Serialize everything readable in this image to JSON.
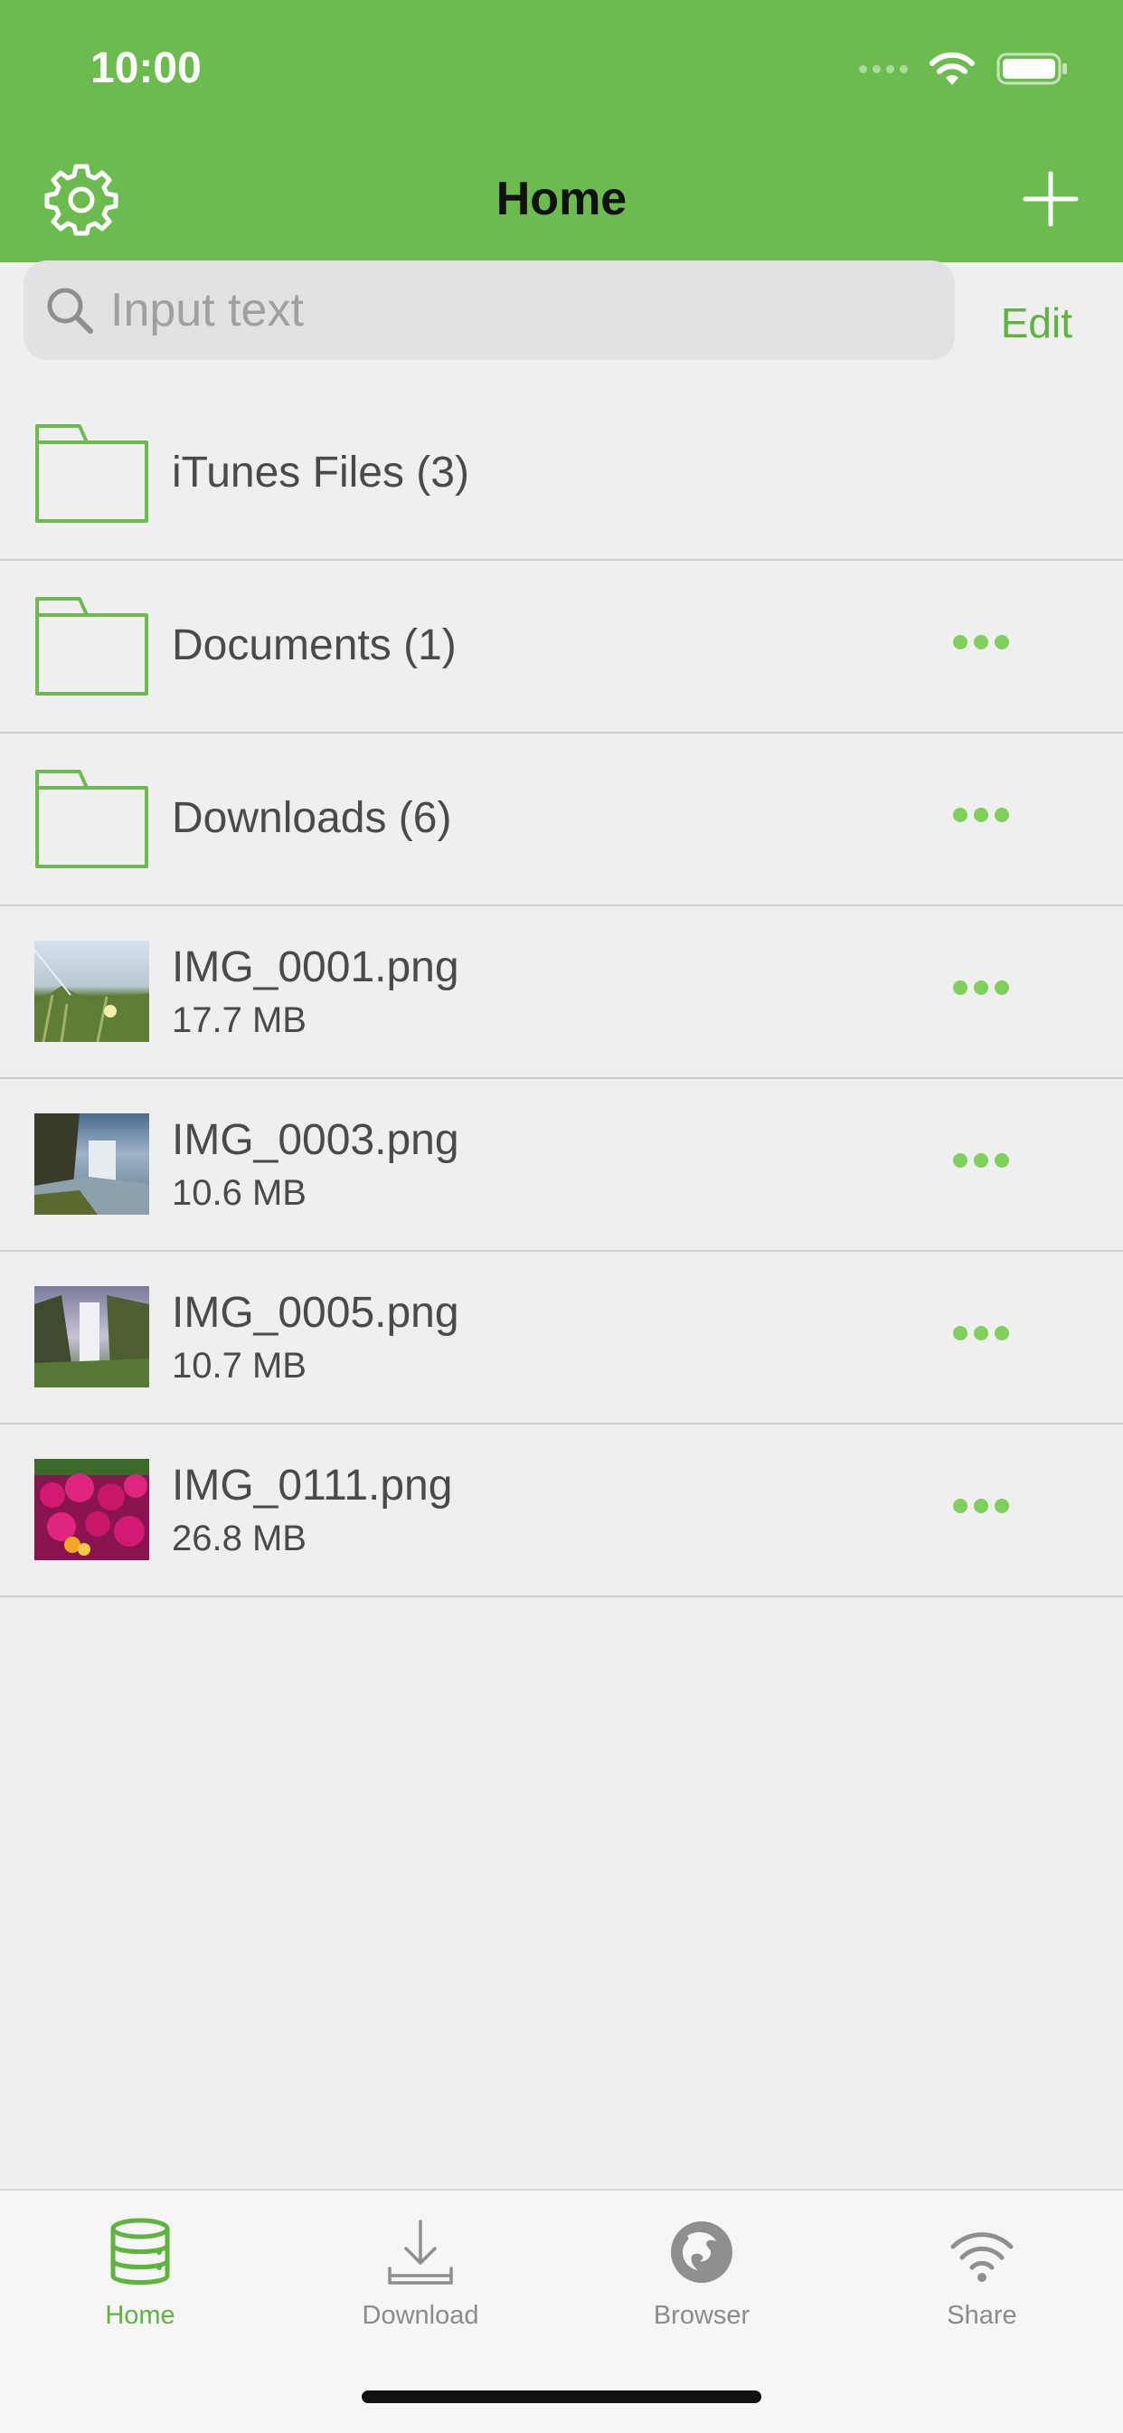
{
  "status": {
    "time": "10:00"
  },
  "nav": {
    "title": "Home",
    "settings_icon": "gear-icon",
    "add_icon": "plus-icon"
  },
  "search": {
    "placeholder": "Input text",
    "value": ""
  },
  "edit_label": "Edit",
  "colors": {
    "accent": "#6cbb4f",
    "accent_text": "#5fb33f",
    "background": "#efefef"
  },
  "items": [
    {
      "type": "folder",
      "title": "iTunes Files (3)",
      "has_menu": false
    },
    {
      "type": "folder",
      "title": "Documents (1)",
      "has_menu": true
    },
    {
      "type": "folder",
      "title": "Downloads (6)",
      "has_menu": true
    },
    {
      "type": "file",
      "title": "IMG_0001.png",
      "size": "17.7 MB",
      "has_menu": true
    },
    {
      "type": "file",
      "title": "IMG_0003.png",
      "size": "10.6 MB",
      "has_menu": true
    },
    {
      "type": "file",
      "title": "IMG_0005.png",
      "size": "10.7 MB",
      "has_menu": true
    },
    {
      "type": "file",
      "title": "IMG_0111.png",
      "size": "26.8 MB",
      "has_menu": true
    }
  ],
  "tabs": [
    {
      "label": "Home",
      "icon": "database-icon",
      "active": true
    },
    {
      "label": "Download",
      "icon": "download-icon",
      "active": false
    },
    {
      "label": "Browser",
      "icon": "browser-globe-icon",
      "active": false
    },
    {
      "label": "Share",
      "icon": "wifi-share-icon",
      "active": false
    }
  ]
}
